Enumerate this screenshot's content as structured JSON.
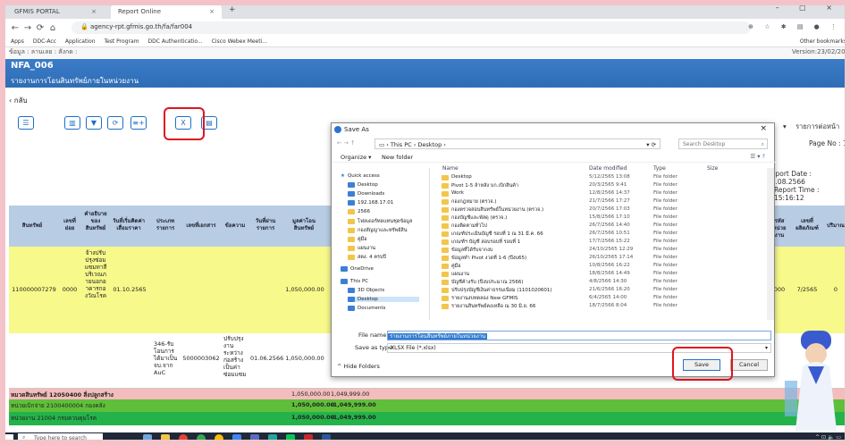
{
  "browser": {
    "tabs": [
      {
        "label": "GFMIS PORTAL"
      },
      {
        "label": "Report Online"
      }
    ],
    "url": "agency-rpt.gfmis.go.th/fa/far004",
    "bookmarks": [
      "Apps",
      "DDC-Acc",
      "Application",
      "Test Program",
      "DDC Authenticatio...",
      "Cisco Webex Meeti..."
    ],
    "other_bookmarks": "Other bookmarks"
  },
  "page": {
    "subinfo_left": "ข้อมูล : ลานเลย : สังกด :",
    "version": "Version:23/02/202",
    "report_code": "NFA_006",
    "report_title": "รายงานการโอนสินทรัพย์ภายในหน่วยงาน",
    "back": "กลับ",
    "right_select": "รายการต่อหน้า",
    "page_no": "Page No : 1",
    "report_date": "Report Date : 16.08.2566",
    "report_time": "Report Time : 15:16:12"
  },
  "table": {
    "headers": [
      "สินทรัพย์",
      "เลขที่ย่อย",
      "คำอธิบายของสินทรัพย์",
      "วันที่เริ่มคิดค่าเสื่อมราคา",
      "ประเภทรายการ",
      "เลขที่เอกสาร",
      "ข้อความ",
      "วันที่ผ่านรายการ",
      "มูลค่าโอนสินทรัพย์",
      "รหัสหน่วยงาน",
      "เลขที่ผลิตภัณฑ์",
      "ปริมาณ"
    ],
    "yellow_row": {
      "asset": "110000007279",
      "sub": "0000",
      "desc": "จ้างปรับปรุงซ่อมแซมทาสีบริเวณภายนอกอาคารกองวัณโรค",
      "start_date": "01.10.2565",
      "amount": "1,050,000.00",
      "right_code": "000",
      "right_no": "7/2565",
      "right_qty": "0"
    },
    "white_row": {
      "type": "346-รับโอนการได้มาเป็นจบ.จาก AuC",
      "doc": "5000003062",
      "text": "ปรับปรุงงานระหว่างก่อสร้างเป็นค่าซ่อมแซม",
      "post_date": "01.06.2566",
      "amount": "1,050,000.00"
    },
    "summary": [
      {
        "label": "หมวดสินทรัพย์ 12050400 สิ่งปลูกสร้าง",
        "v1": "1,050,000.00",
        "v2": "1,049,999.00"
      },
      {
        "label": "หน่วยเบิกจ่าย 2100400004 กองคลัง",
        "v1": "1,050,000.00",
        "v2": "-1,049,999.00"
      },
      {
        "label": "หน่วยงาน 21004 กรมควบคุมโรค",
        "v1": "1,050,000.00",
        "v2": "-1,049,999.00"
      }
    ]
  },
  "dialog": {
    "title": "Save As",
    "path": "This PC › Desktop ›",
    "search_placeholder": "Search Desktop",
    "organize": "Organize ▾",
    "new_folder": "New folder",
    "cols": {
      "name": "Name",
      "date": "Date modified",
      "type": "Type",
      "size": "Size"
    },
    "nav": [
      {
        "label": "Quick access",
        "kind": "star"
      },
      {
        "label": "Desktop",
        "kind": "blue"
      },
      {
        "label": "Downloads",
        "kind": "blue"
      },
      {
        "label": "192.168.17.01",
        "kind": "blue"
      },
      {
        "label": "2566",
        "kind": "folder"
      },
      {
        "label": "โฟลเดอร์ทดแทนชุดข้อมูล",
        "kind": "folder"
      },
      {
        "label": "กองสัญญาและทรัพย์สิน",
        "kind": "folder"
      },
      {
        "label": "คู่มือ",
        "kind": "folder"
      },
      {
        "label": "แผนงาน",
        "kind": "folder"
      },
      {
        "label": "สตง. 4 ครบปี",
        "kind": "folder"
      },
      {
        "label": "OneDrive",
        "kind": "blue"
      },
      {
        "label": "This PC",
        "kind": "blue"
      },
      {
        "label": "3D Objects",
        "kind": "blue"
      },
      {
        "label": "Desktop",
        "kind": "blue"
      },
      {
        "label": "Documents",
        "kind": "blue"
      }
    ],
    "files": [
      {
        "name": "Desktop",
        "date": "5/12/2565 13:08",
        "type": "File folder"
      },
      {
        "name": "Pivot 1-5 ล้าหลัง บก.เบิกสินค้า",
        "date": "20/3/2565 9:41",
        "type": "File folder"
      },
      {
        "name": "Work",
        "date": "12/8/2566 14:37",
        "type": "File folder"
      },
      {
        "name": "กองกฎหมาย (ตรวจ.)",
        "date": "21/7/2566 17:27",
        "type": "File folder"
      },
      {
        "name": "กองตรวจสอบสินทรัพย์ในหน่วยงาน (ตรวจ.)",
        "date": "20/7/2566 17:03",
        "type": "File folder"
      },
      {
        "name": "กองบัญชีและพัสดุ (ตรวจ.)",
        "date": "15/8/2566 17:10",
        "type": "File folder"
      },
      {
        "name": "กองติดตามทั่วไป",
        "date": "26/7/2566 14:40",
        "type": "File folder"
      },
      {
        "name": "เกณฑ์ประเมินบัญชี รอบที่ 1 ณ 31 มี.ค. 66",
        "date": "26/7/2566 10:51",
        "type": "File folder"
      },
      {
        "name": "เกณฑ์ฯ บัญชี สอบรอบที่ รอบที่ 1",
        "date": "17/7/2566 15:22",
        "type": "File folder"
      },
      {
        "name": "ข้อมูลที่ได้รับจากงบ",
        "date": "24/10/2565 12:29",
        "type": "File folder"
      },
      {
        "name": "ข้อมูลทำ Pivot งวดที่ 1-6 (ปีงบ65)",
        "date": "26/10/2565 17:14",
        "type": "File folder"
      },
      {
        "name": "คู่มือ",
        "date": "10/8/2566 16:22",
        "type": "File folder"
      },
      {
        "name": "แผนงาน",
        "date": "18/8/2566 14:49",
        "type": "File folder"
      },
      {
        "name": "บัญชีค้างรับ (ปีงบประมาณ 2566)",
        "date": "4/8/2566 14:30",
        "type": "File folder"
      },
      {
        "name": "ปรับปรุงบัญชีเงินค่าธรรมเนียม (1101020601)",
        "date": "21/6/2566 16:20",
        "type": "File folder"
      },
      {
        "name": "รายงานงบทดลอง New GFMIS",
        "date": "6/4/2565 14:00",
        "type": "File folder"
      },
      {
        "name": "รายงานสินทรัพย์คงเหลือ ณ 30 มิ.ย. 66",
        "date": "18/7/2566 8:04",
        "type": "File folder"
      }
    ],
    "filename_label": "File name:",
    "filename_value": "รายงานการโอนสินทรัพย์ภายในหน่วยงาน",
    "savetype_label": "Save as type:",
    "savetype_value": "XLSX File (*.xlsx)",
    "hide_folders": "Hide Folders",
    "save": "Save",
    "cancel": "Cancel"
  },
  "taskbar": {
    "search_placeholder": "Type here to search"
  }
}
